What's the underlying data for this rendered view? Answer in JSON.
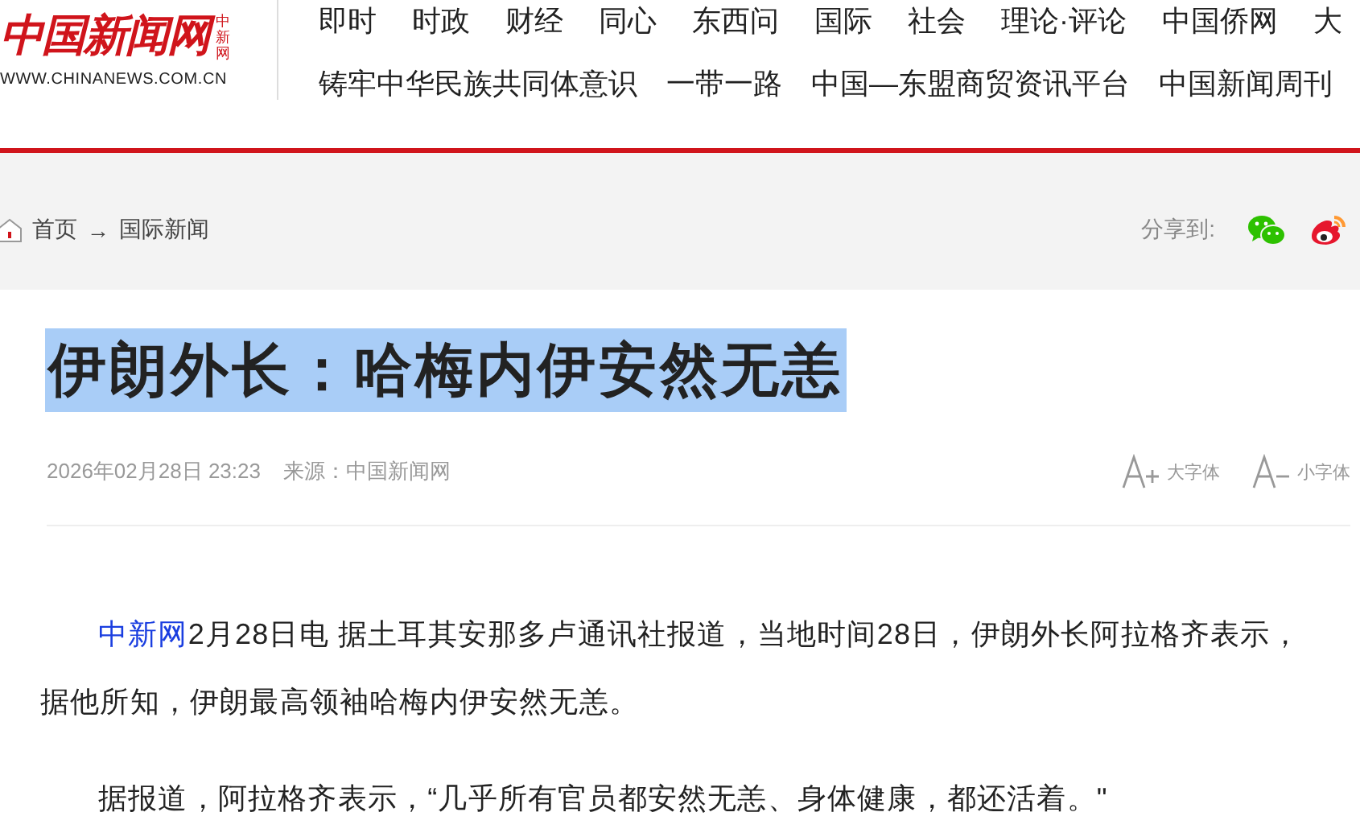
{
  "logo": {
    "name": "中国新闻网",
    "mark": "中新网",
    "url": "WWW.CHINANEWS.COM.CN"
  },
  "nav": {
    "channels": [
      "即时",
      "时政",
      "财经",
      "同心",
      "东西问",
      "国际",
      "社会",
      "理论·评论",
      "中国侨网",
      "大"
    ],
    "topics": [
      "铸牢中华民族共同体意识",
      "一带一路",
      "中国—东盟商贸资讯平台",
      "中国新闻周刊"
    ]
  },
  "breadcrumb": {
    "items": [
      "首页",
      "国际新闻"
    ],
    "separator": "→"
  },
  "share": {
    "label": "分享到:"
  },
  "article": {
    "title": "伊朗外长：哈梅内伊安然无恙",
    "title_selected": true,
    "date": "2026年02月28日 23:23",
    "source": "来源：中国新闻网",
    "font_controls": [
      {
        "kind": "larger",
        "label": "大字体"
      },
      {
        "kind": "smaller",
        "label": "小字体"
      }
    ],
    "paragraphs": [
      {
        "link": "中新网",
        "text": "2月28日电 据土耳其安那多卢通讯社报道，当地时间28日，伊朗外长阿拉格齐表示，据他所知，伊朗最高领袖哈梅内伊安然无恙。"
      },
      {
        "text": "据报道，阿拉格齐表示，“几乎所有官员都安然无恙、身体健康，都还活着。\""
      }
    ]
  }
}
